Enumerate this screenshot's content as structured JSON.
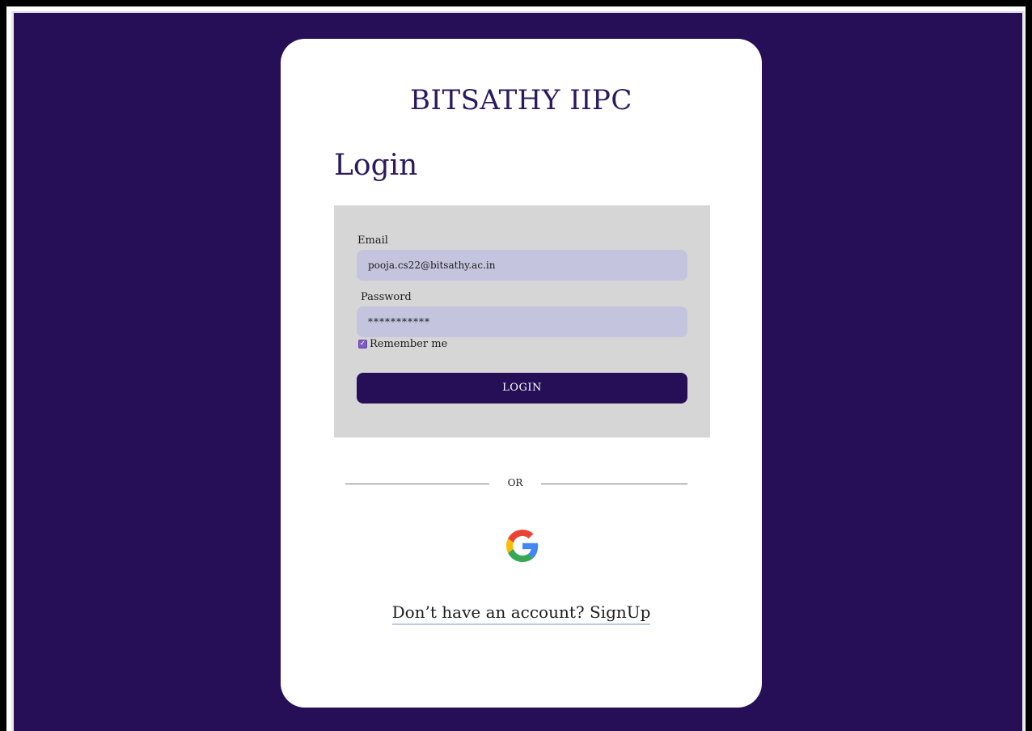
{
  "brand": {
    "title": "BITSATHY IIPC"
  },
  "login": {
    "heading": "Login",
    "email_label": "Email",
    "email_value": "pooja.cs22@bitsathy.ac.in",
    "password_label": "Password",
    "password_value": "***********",
    "remember_label": "Remember me",
    "remember_checked": true,
    "submit_label": "LOGIN"
  },
  "divider": {
    "text": "OR"
  },
  "google": {
    "icon": "google-icon"
  },
  "signup": {
    "text": "Don’t have an account? SignUp"
  },
  "colors": {
    "background": "#260f57",
    "card": "#ffffff",
    "panel": "#d6d6d6",
    "input": "#c5c4de",
    "button": "#260f57",
    "title": "#2b1a5e"
  }
}
